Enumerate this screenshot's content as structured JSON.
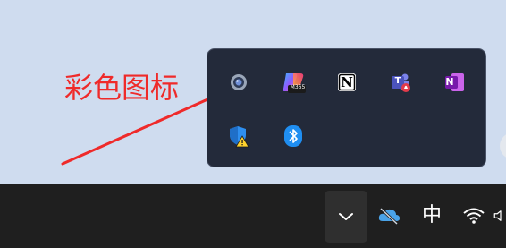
{
  "annotation": {
    "text": "彩色图标",
    "color": "#ef2a2a"
  },
  "tray_overflow": {
    "icons": [
      {
        "name": "webcam-icon"
      },
      {
        "name": "microsoft-365-copilot-icon",
        "badge": "M365"
      },
      {
        "name": "notion-icon",
        "letter": "N"
      },
      {
        "name": "teams-icon",
        "letter": "T"
      },
      {
        "name": "onenote-icon",
        "letter": "N"
      },
      {
        "name": "windows-security-warning-icon"
      },
      {
        "name": "bluetooth-icon"
      }
    ]
  },
  "taskbar": {
    "chevron": "chevron-up-icon",
    "onedrive": "onedrive-cloud-off-icon",
    "ime_label": "中",
    "wifi": "wifi-icon",
    "volume": "volume-icon"
  },
  "colors": {
    "desktop_bg": "#cfdcef",
    "flyout_bg": "#232a3a",
    "taskbar_bg": "#1f1f1f",
    "annotation_red": "#ef2a2a"
  }
}
